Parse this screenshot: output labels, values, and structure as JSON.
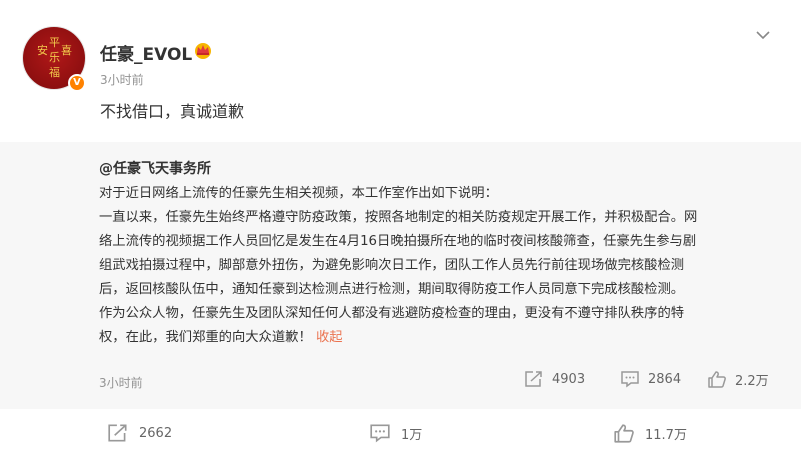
{
  "post": {
    "username": "任豪_EVOL",
    "time": "3小时前",
    "text": "不找借口，真诚道歉",
    "avatar_glyphs": [
      "平",
      "安",
      "喜",
      "乐",
      "福"
    ]
  },
  "repost": {
    "author": "@任豪飞天事务所",
    "lines": [
      "对于近日网络上流传的任豪先生相关视频，本工作室作出如下说明：",
      "一直以来，任豪先生始终严格遵守防疫政策，按照各地制定的相关防疫规定开展工作，并积极配合。网",
      "络上流传的视频据工作人员回忆是发生在4月16日晚拍摄所在地的临时夜间核酸筛查，任豪先生参与剧",
      "组武戏拍摄过程中，脚部意外扭伤，为避免影响次日工作，团队工作人员先行前往现场做完核酸检测",
      "后，返回核酸队伍中，通知任豪到达检测点进行检测，期间取得防疫工作人员同意下完成核酸检测。",
      "作为公众人物，任豪先生及团队深知任何人都没有逃避防疫检查的理由，更没有不遵守排队秩序的特",
      "权，在此，我们郑重的向大众道歉！"
    ],
    "collapse_label": "收起",
    "time": "3小时前",
    "reposts": "4903",
    "comments": "2864",
    "likes": "2.2万"
  },
  "footer": {
    "reposts": "2662",
    "comments": "1万",
    "likes": "11.7万"
  },
  "icons": {
    "more": "chevron-down-icon",
    "repost": "repost-icon",
    "comment": "comment-icon",
    "like": "thumb-up-icon",
    "verified": "verified-v-icon",
    "crown": "crown-icon"
  },
  "colors": {
    "verified_badge": "#ff8200",
    "collapse_link": "#eb7350",
    "repost_background": "#f7f7f7"
  }
}
